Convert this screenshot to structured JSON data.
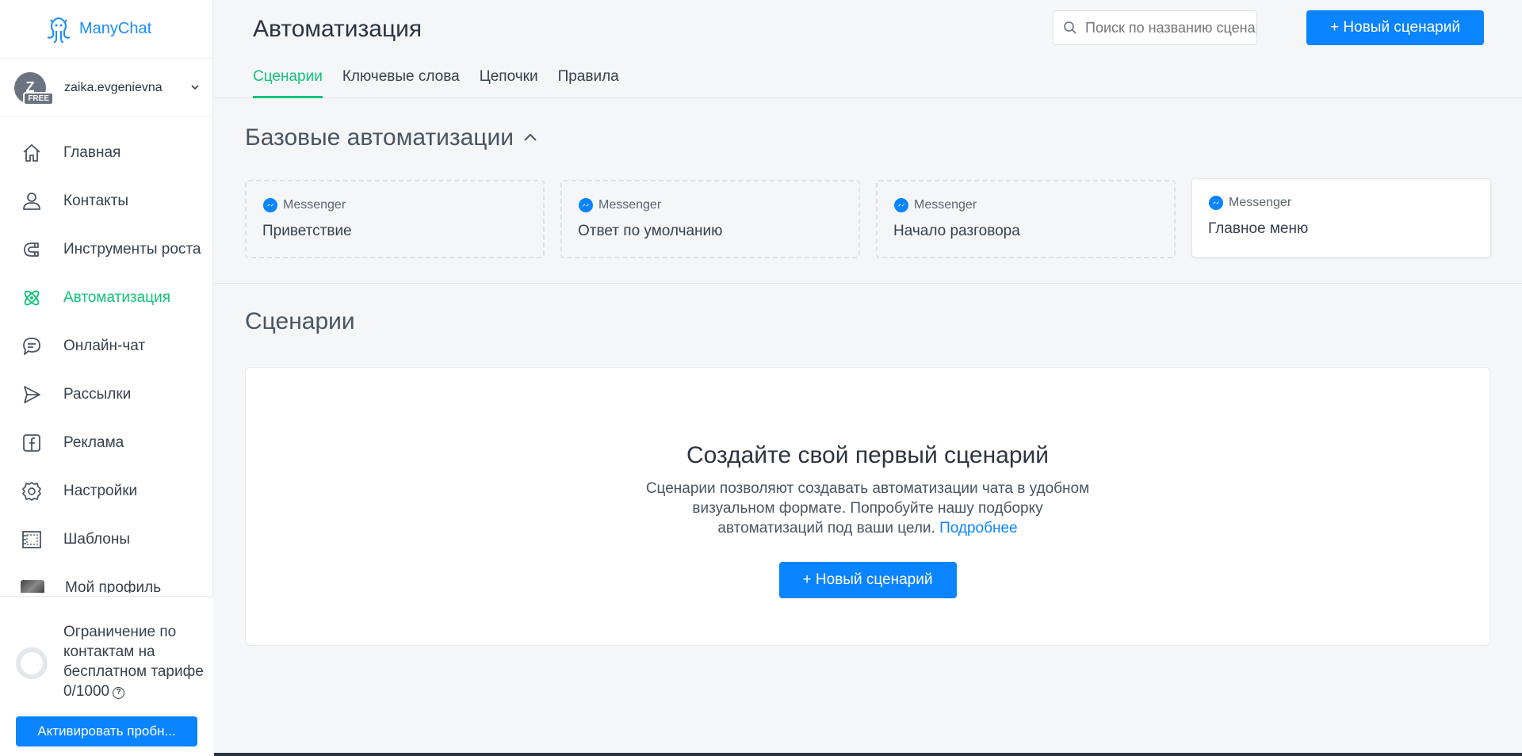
{
  "brand": {
    "name": "ManyChat",
    "color": "#1a8cff"
  },
  "account": {
    "initial": "Z",
    "badge": "FREE",
    "username": "zaika.evgenievna"
  },
  "nav": {
    "items": [
      {
        "label": "Главная",
        "icon": "home-icon"
      },
      {
        "label": "Контакты",
        "icon": "user-icon"
      },
      {
        "label": "Инструменты роста",
        "icon": "magnet-icon"
      },
      {
        "label": "Автоматизация",
        "icon": "atom-icon",
        "active": true
      },
      {
        "label": "Онлайн-чат",
        "icon": "chat-icon"
      },
      {
        "label": "Рассылки",
        "icon": "send-icon"
      },
      {
        "label": "Реклама",
        "icon": "facebook-icon"
      },
      {
        "label": "Настройки",
        "icon": "gear-icon"
      },
      {
        "label": "Шаблоны",
        "icon": "template-icon"
      },
      {
        "label": "Мой профиль",
        "icon": "profile-photo"
      }
    ]
  },
  "limit": {
    "text": "Ограничение по контактам на бесплатном тарифе",
    "count": "0/1000",
    "activate_label": "Активировать пробн..."
  },
  "header": {
    "title": "Автоматизация",
    "search_placeholder": "Поиск по названию сценария",
    "new_button": "+ Новый сценарий",
    "tabs": [
      "Сценарии",
      "Ключевые слова",
      "Цепочки",
      "Правила"
    ]
  },
  "basic": {
    "title": "Базовые автоматизации",
    "cards": [
      {
        "channel": "Messenger",
        "title": "Приветствие"
      },
      {
        "channel": "Messenger",
        "title": "Ответ по умолчанию"
      },
      {
        "channel": "Messenger",
        "title": "Начало разговора"
      },
      {
        "channel": "Messenger",
        "title": "Главное меню"
      }
    ]
  },
  "scenarios": {
    "title": "Сценарии",
    "empty_title": "Создайте свой первый сценарий",
    "empty_text": "Сценарии позволяют создавать автоматизации чата в удобном визуальном формате. Попробуйте нашу подборку автоматизаций под ваши цели.",
    "more_link": "Подробнее",
    "new_button": "+ Новый сценарий"
  },
  "colors": {
    "accent": "#0a84ff",
    "active": "#11c37a"
  }
}
